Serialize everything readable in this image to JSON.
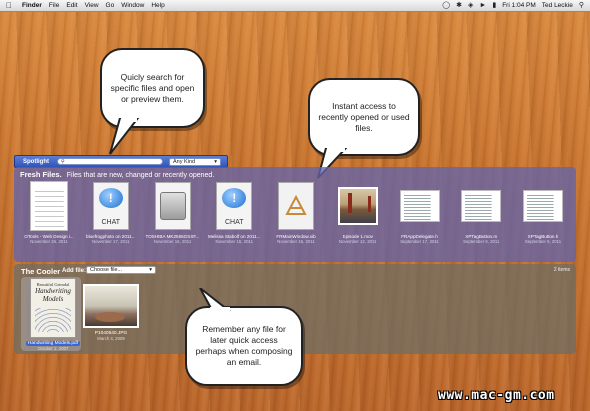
{
  "menubar": {
    "app": "Finder",
    "menus": [
      "File",
      "Edit",
      "View",
      "Go",
      "Window",
      "Help"
    ],
    "clock": "Fri 1:04 PM",
    "user": "Ted Leckie"
  },
  "callouts": {
    "search": "Quicly search for specific files and open or preview them.",
    "recent": "Instant access to recently opened or used files.",
    "cooler": "Remember any file for later quick access perhaps when composing an email."
  },
  "spotlight": {
    "label": "Spotlight",
    "placeholder": "",
    "kind": "Any Kind"
  },
  "fresh": {
    "title": "Fresh Files.",
    "subtitle": "Files that are new, changed or recently opened.",
    "files": [
      {
        "name": "OTools - Web Design i...",
        "date": "November 26, 2011",
        "kind": "doc"
      },
      {
        "name": "bluefrogphoto on 2011...",
        "date": "November 17, 2011",
        "kind": "chat"
      },
      {
        "name": "TOSHIBA MK2555GSXF...",
        "date": "November 16, 2011",
        "kind": "drive"
      },
      {
        "name": "Melissa Stabolf on 2011...",
        "date": "November 15, 2011",
        "kind": "chat"
      },
      {
        "name": "FRMainWindow.xib",
        "date": "November 15, 2011",
        "kind": "xib"
      },
      {
        "name": "Episode 1.mov",
        "date": "November 12, 2011",
        "kind": "movie"
      },
      {
        "name": "FRAppDelegate.h",
        "date": "September 17, 2011",
        "kind": "code"
      },
      {
        "name": "XPTagButton.m",
        "date": "September 6, 2011",
        "kind": "code"
      },
      {
        "name": "XPTagButton.h",
        "date": "September 6, 2011",
        "kind": "code"
      }
    ]
  },
  "cooler": {
    "title": "The Cooler",
    "add_label": "Add file:",
    "choose_label": "Choose file...",
    "count": "2 items",
    "files": [
      {
        "name": "Handwriting Models.pdf",
        "date": "October 1, 2007",
        "book_t1": "Beautiful Grimdal",
        "book_t2": "Handwriting Models"
      },
      {
        "name": "P1040540.JPG",
        "date": "March 4, 2009"
      }
    ]
  },
  "chat_text": "CHAT",
  "watermark": "www.mac-gm.com"
}
